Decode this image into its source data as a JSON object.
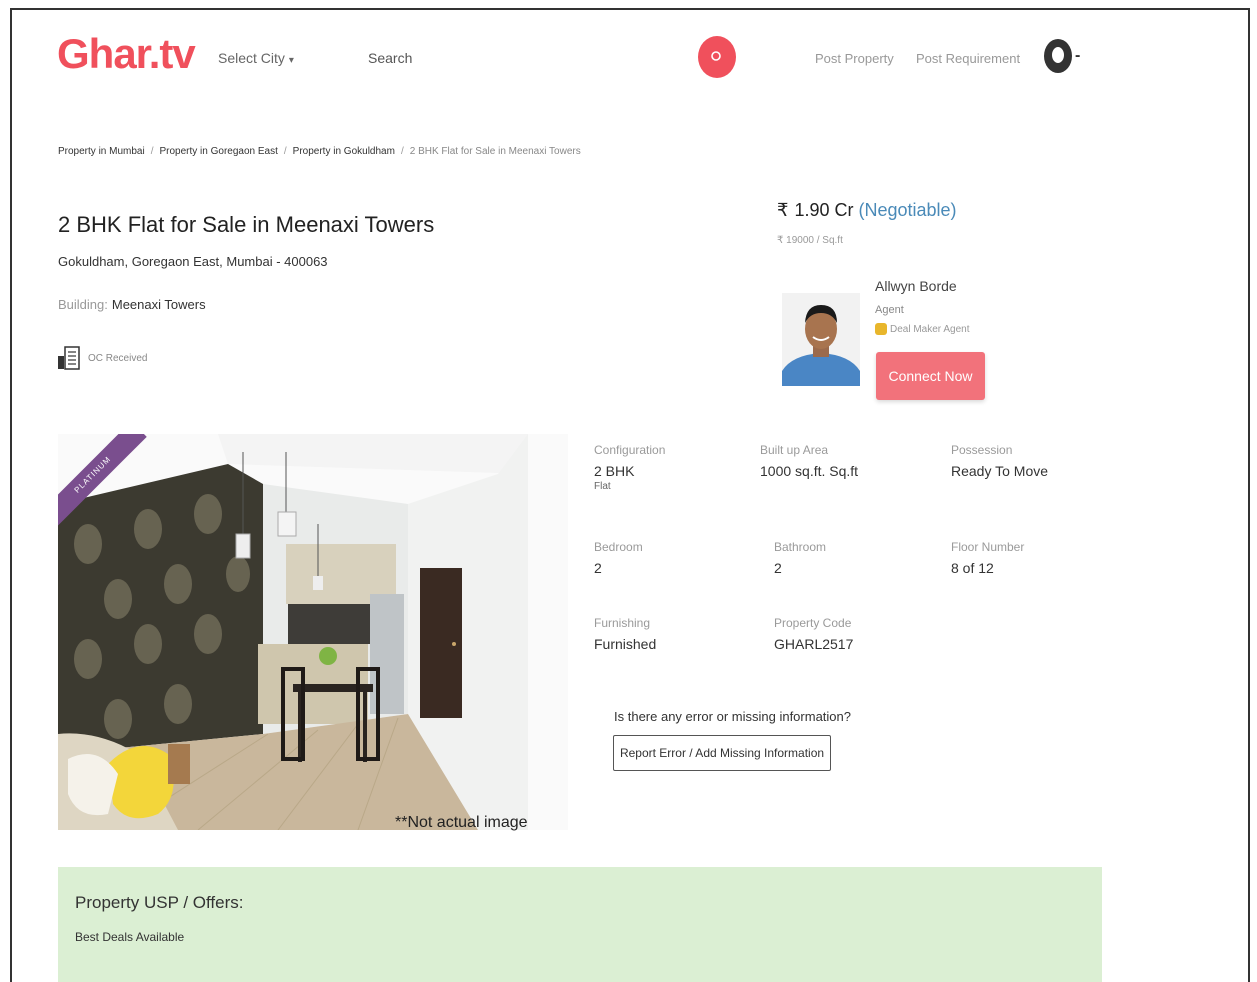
{
  "header": {
    "logo": "Ghar.tv",
    "select_city": "Select City",
    "search_label": "Search",
    "post_property": "Post Property",
    "post_requirement": "Post Requirement"
  },
  "breadcrumb": {
    "items": [
      "Property in Mumbai",
      "Property in Goregaon East",
      "Property in Gokuldham",
      "2 BHK Flat for Sale in Meenaxi Towers"
    ],
    "separator": "/"
  },
  "listing": {
    "title": "2 BHK Flat for Sale in Meenaxi Towers",
    "address": "Gokuldham, Goregaon East, Mumbai - 400063",
    "building_label": "Building:",
    "building_value": "Meenaxi Towers",
    "oc_status": "OC Received",
    "badge": "PLATINUM",
    "image_note": "**Not actual image"
  },
  "price": {
    "symbol": "₹",
    "amount": "1.90 Cr",
    "negotiable": "(Negotiable)",
    "per_sqft": "₹ 19000 / Sq.ft"
  },
  "agent": {
    "name": "Allwyn Borde",
    "role": "Agent",
    "badge": "Deal Maker Agent",
    "connect_label": "Connect Now"
  },
  "details": {
    "configuration": {
      "label": "Configuration",
      "value": "2 BHK",
      "sub": "Flat"
    },
    "built_up_area": {
      "label": "Built up Area",
      "value": "1000 sq.ft. Sq.ft"
    },
    "possession": {
      "label": "Possession",
      "value": "Ready To Move"
    },
    "bedroom": {
      "label": "Bedroom",
      "value": "2"
    },
    "bathroom": {
      "label": "Bathroom",
      "value": "2"
    },
    "floor_number": {
      "label": "Floor Number",
      "value": "8 of 12"
    },
    "furnishing": {
      "label": "Furnishing",
      "value": "Furnished"
    },
    "property_code": {
      "label": "Property Code",
      "value": "GHARL2517"
    }
  },
  "error_report": {
    "question": "Is there any error or missing information?",
    "button_label": "Report Error / Add Missing Information"
  },
  "usp": {
    "title": "Property USP / Offers:",
    "item": "Best Deals Available"
  },
  "colors": {
    "brand": "#f0505c",
    "connect": "#f2727b",
    "negotiable": "#4a8ab8",
    "usp_bg": "#dbefd3",
    "platinum": "#7a4e8e"
  }
}
